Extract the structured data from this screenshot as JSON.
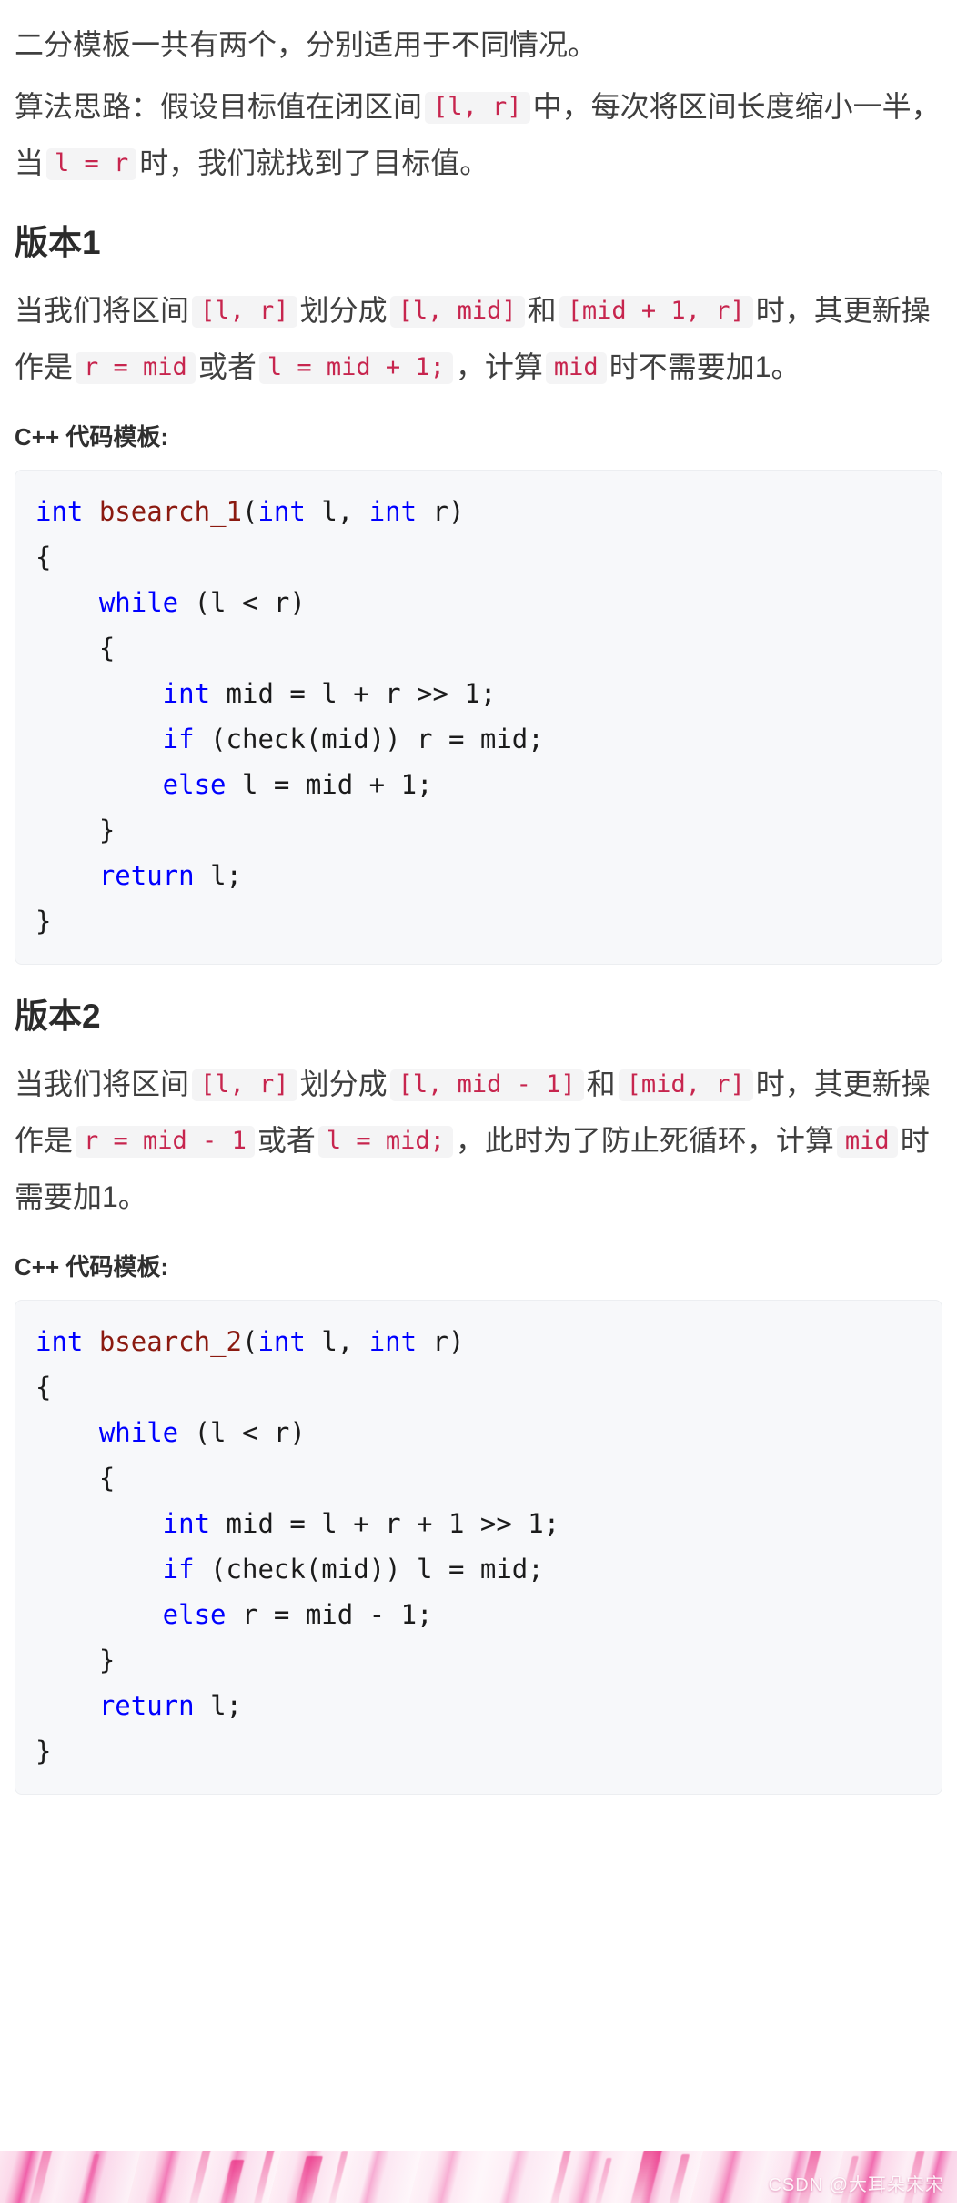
{
  "intro": {
    "line1": "二分模板一共有两个，分别适用于不同情况。",
    "line2_part1": "算法思路：假设目标值在闭区间",
    "line2_code1": "[l, r]",
    "line2_part2": "中，每次将区间长度缩小一半，当",
    "line2_code2": "l = r",
    "line2_part3": "时，我们就找到了目标值。"
  },
  "version1": {
    "heading": "版本1",
    "desc_part1": "当我们将区间",
    "desc_code1": "[l, r]",
    "desc_part2": "划分成",
    "desc_code2": "[l, mid]",
    "desc_part3": "和",
    "desc_code3": "[mid + 1, r]",
    "desc_part4": "时，其更新操作是",
    "desc_code4": "r = mid",
    "desc_part5": "或者",
    "desc_code5": "l = mid + 1;",
    "desc_part6": "，计算",
    "desc_code6": "mid",
    "desc_part7": "时不需要加1。",
    "code_label": "C++ 代码模板:",
    "code": {
      "l1_kw1": "int",
      "l1_fn": " bsearch_1",
      "l1_p1": "(",
      "l1_kw2": "int",
      "l1_p2": " l, ",
      "l1_kw3": "int",
      "l1_p3": " r)",
      "l2": "{",
      "l3_kw": "    while",
      "l3_p": " (l < r)",
      "l4": "    {",
      "l5_kw": "        int",
      "l5_p": " mid = l + r >> 1;",
      "l6_kw": "        if",
      "l6_p": " (check(mid)) r = mid;",
      "l7_kw": "        else",
      "l7_p": " l = mid + 1;",
      "l8": "    }",
      "l9_kw": "    return",
      "l9_p": " l;",
      "l10": "}"
    }
  },
  "version2": {
    "heading": "版本2",
    "desc_part1": "当我们将区间",
    "desc_code1": "[l, r]",
    "desc_part2": "划分成",
    "desc_code2": "[l, mid - 1]",
    "desc_part3": "和",
    "desc_code3": "[mid, r]",
    "desc_part4": "时，其更新操作是",
    "desc_code4": "r = mid - 1",
    "desc_part5": "或者",
    "desc_code5": "l = mid;",
    "desc_part6": "，此时为了防止死循环，计算",
    "desc_code6": "mid",
    "desc_part7": "时需要加1。",
    "code_label": "C++ 代码模板:",
    "code": {
      "l1_kw1": "int",
      "l1_fn": " bsearch_2",
      "l1_p1": "(",
      "l1_kw2": "int",
      "l1_p2": " l, ",
      "l1_kw3": "int",
      "l1_p3": " r)",
      "l2": "{",
      "l3_kw": "    while",
      "l3_p": " (l < r)",
      "l4": "    {",
      "l5_kw": "        int",
      "l5_p": " mid = l + r + 1 >> 1;",
      "l6_kw": "        if",
      "l6_p": " (check(mid)) l = mid;",
      "l7_kw": "        else",
      "l7_p": " r = mid - 1;",
      "l8": "    }",
      "l9_kw": "    return",
      "l9_p": " l;",
      "l10": "}"
    }
  },
  "banner": {
    "watermark": "CSDN @大耳朵宋宋"
  },
  "colors": {
    "chip_text": "#c7254e",
    "chip_bg": "#f4f4f5",
    "keyword": "#0000ff",
    "function": "#8b1a10",
    "code_bg": "#f7f8fa",
    "body_text": "#3f3f3f",
    "heading_text": "#2b2b2b"
  }
}
